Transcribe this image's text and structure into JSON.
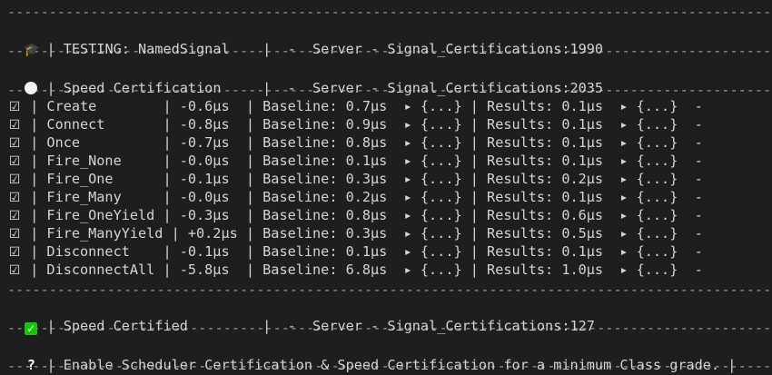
{
  "separator": "------------------------------------------------------------------------------------------------------------",
  "header": {
    "icon": "graduation-cap-icon",
    "glyph": "🎓",
    "text": " | TESTING: NamedSignal    |  -  Server - Signal_Certifications:1990"
  },
  "speed_header": {
    "icon": "white-circle-icon",
    "text": " | Speed Certification     |  -  Server - Signal_Certifications:2035"
  },
  "rows": [
    {
      "check": "☑",
      "text": " | Create        | -0.6μs  | Baseline: 0.7μs  ▸ {...} | Results: 0.1μs  ▸ {...}  -"
    },
    {
      "check": "☑",
      "text": " | Connect       | -0.8μs  | Baseline: 0.9μs  ▸ {...} | Results: 0.1μs  ▸ {...}  -"
    },
    {
      "check": "☑",
      "text": " | Once          | -0.7μs  | Baseline: 0.8μs  ▸ {...} | Results: 0.1μs  ▸ {...}  -"
    },
    {
      "check": "☑",
      "text": " | Fire_None     | -0.0μs  | Baseline: 0.1μs  ▸ {...} | Results: 0.1μs  ▸ {...}  -"
    },
    {
      "check": "☑",
      "text": " | Fire_One      | -0.1μs  | Baseline: 0.3μs  ▸ {...} | Results: 0.2μs  ▸ {...}  -"
    },
    {
      "check": "☑",
      "text": " | Fire_Many     | -0.0μs  | Baseline: 0.2μs  ▸ {...} | Results: 0.1μs  ▸ {...}  -"
    },
    {
      "check": "☑",
      "text": " | Fire_OneYield | -0.3μs  | Baseline: 0.8μs  ▸ {...} | Results: 0.6μs  ▸ {...}  -"
    },
    {
      "check": "☑",
      "text": " | Fire_ManyYield | +0.2μs | Baseline: 0.3μs  ▸ {...} | Results: 0.5μs  ▸ {...}  -"
    },
    {
      "check": "☑",
      "text": " | Disconnect    | -0.1μs  | Baseline: 0.1μs  ▸ {...} | Results: 0.1μs  ▸ {...}  -"
    },
    {
      "check": "☑",
      "text": " | DisconnectAll | -5.8μs  | Baseline: 6.8μs  ▸ {...} | Results: 1.0μs  ▸ {...}  -"
    }
  ],
  "certified": {
    "icon": "green-check-icon",
    "glyph": "✓",
    "text": " | Speed Certified         |  -  Server - Signal_Certifications:127"
  },
  "footer": {
    "glyph": "?",
    "text": " | Enable Scheduler Certification & Speed Certification for a minimum Class grade. |"
  },
  "colors": {
    "background": "#1e1e1e",
    "text": "#d4d4d4",
    "separator": "#9a9a9a",
    "success": "#16c60c"
  }
}
